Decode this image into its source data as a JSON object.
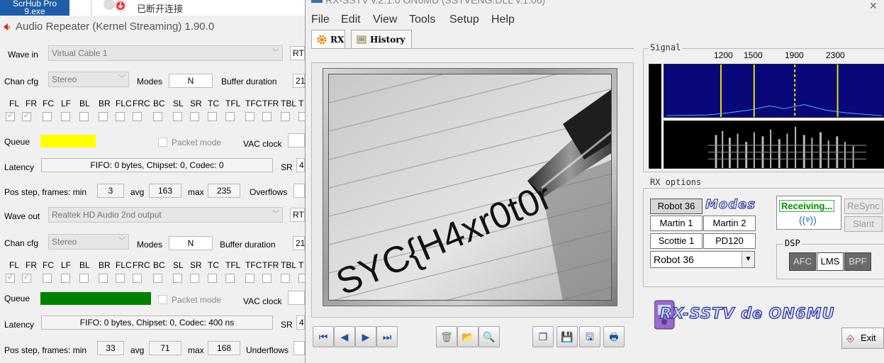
{
  "background": {
    "scrhub_label": "ScrHub Pro\n9.exe",
    "disconnected_text": "已断开连接"
  },
  "audio_repeater": {
    "title": "Audio Repeater (Kernel Streaming) 1.90.0",
    "wave_in": {
      "label": "Wave in",
      "device": "Virtual Cable 1",
      "extra": "RT",
      "chan_cfg_label": "Chan cfg",
      "chan_cfg_value": "Stereo",
      "modes_label": "Modes",
      "modes_value": "N",
      "buffer_label": "Buffer duration",
      "buffer_value": "21",
      "channels": [
        "FL",
        "FR",
        "FC",
        "LF",
        "BL",
        "BR",
        "FLC",
        "FRC",
        "BC",
        "SL",
        "SR",
        "TC",
        "TFL",
        "TFC",
        "TFR",
        "TBL",
        "T"
      ],
      "queue_label": "Queue",
      "queue_color": "#ffff00",
      "packet_mode": "Packet mode",
      "vac_clock": "VAC clock",
      "latency_label": "Latency",
      "latency_value": "FIFO: 0 bytes, Chipset: 0, Codec: 0",
      "sr_label": "SR",
      "sr_value": "4",
      "pos_step_label": "Pos step, frames: min",
      "min": "3",
      "avg_label": "avg",
      "avg": "163",
      "max_label": "max",
      "max": "235",
      "flows_label": "Overflows"
    },
    "wave_out": {
      "label": "Wave out",
      "device": "Realtek HD Audio 2nd output",
      "extra": "RT",
      "chan_cfg_label": "Chan cfg",
      "chan_cfg_value": "Stereo",
      "modes_label": "Modes",
      "modes_value": "N",
      "buffer_label": "Buffer duration",
      "buffer_value": "21",
      "channels": [
        "FL",
        "FR",
        "FC",
        "LF",
        "BL",
        "BR",
        "FLC",
        "FRC",
        "BC",
        "SL",
        "SR",
        "TC",
        "TFL",
        "TFC",
        "TFR",
        "TBL",
        "T"
      ],
      "queue_label": "Queue",
      "queue_color": "#008000",
      "packet_mode": "Packet mode",
      "vac_clock": "VAC clock",
      "latency_label": "Latency",
      "latency_value": "FIFO: 0 bytes, Chipset: 0, Codec: 400 ns",
      "sr_label": "SR",
      "sr_value": "4",
      "pos_step_label": "Pos step, frames: min",
      "min": "33",
      "avg_label": "avg",
      "avg": "71",
      "max_label": "max",
      "max": "168",
      "flows_label": "Underflows"
    }
  },
  "rx_sstv": {
    "title": "RX-SSTV v.2.1.0 ON6MU (SSTVENG.DLL v.1.06)",
    "menu": [
      "File",
      "Edit",
      "View",
      "Tools",
      "Setup",
      "Help"
    ],
    "tabs": {
      "rx": "RX",
      "history": "History"
    },
    "image_text": "SYC{H4xr0t0r",
    "signal": {
      "title": "Signal",
      "freqs": [
        "1200",
        "1500",
        "1900",
        "2300"
      ]
    },
    "rx_options": {
      "title": "RX options",
      "modes_logo": "Modes",
      "buttons": [
        "Robot 36",
        "Martin 1",
        "Martin 2",
        "Scottie 1",
        "PD120"
      ],
      "selected_mode": "Robot 36",
      "receiving": "Receiving...",
      "resync": "ReSync",
      "slant": "Slant",
      "dsp_title": "DSP",
      "dsp": [
        "AFC",
        "LMS",
        "BPF"
      ]
    },
    "logo_text": "RX-SSTV de ON6MU",
    "exit": "Exit"
  }
}
